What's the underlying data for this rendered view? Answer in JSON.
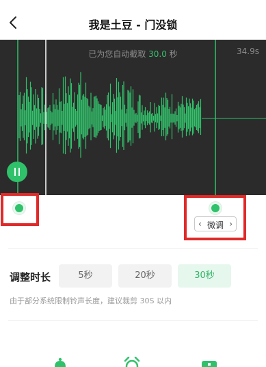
{
  "header": {
    "title": "我是土豆 - 门没锁"
  },
  "editor": {
    "info_prefix": "已为您自动截取 ",
    "info_seconds": "30.0",
    "info_suffix": " 秒",
    "total_time": "34.9s"
  },
  "fine_tune": {
    "label": "微调",
    "left_arrow": "‹",
    "right_arrow": "›"
  },
  "duration": {
    "label": "调整时长",
    "options": [
      {
        "label": "5秒",
        "selected": false
      },
      {
        "label": "20秒",
        "selected": false
      },
      {
        "label": "30秒",
        "selected": true
      }
    ],
    "hint": "由于部分系统限制铃声长度，建议裁剪 30S 以内"
  },
  "colors": {
    "accent": "#2fc26b",
    "wave_bg": "#2b2b2b",
    "highlight": "#e02a2a"
  },
  "icons": {
    "back": "chevron-left-icon",
    "pause": "pause-icon",
    "bottom": [
      "bell-icon",
      "alarm-clock-icon",
      "phone-icon"
    ]
  }
}
